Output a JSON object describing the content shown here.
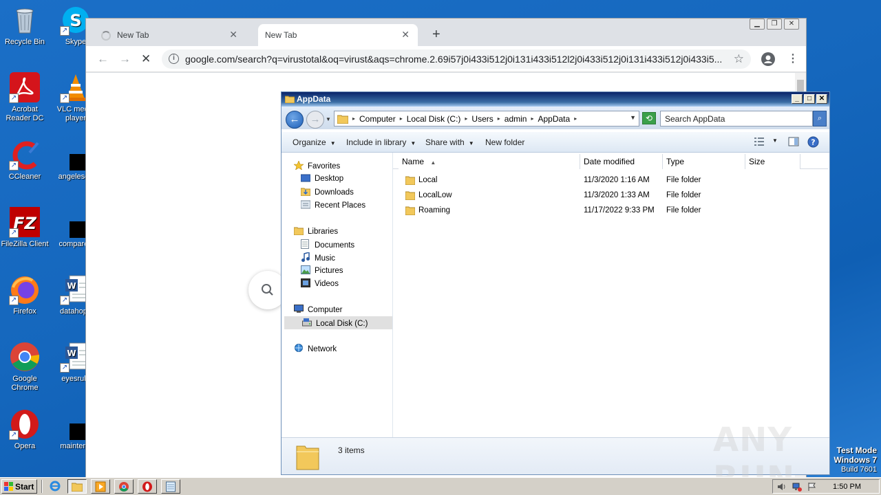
{
  "desktop": {
    "icons": [
      {
        "label": "Recycle Bin",
        "icon": "recycle-bin-icon"
      },
      {
        "label": "Skype",
        "icon": "skype-icon"
      },
      {
        "label": "Acrobat Reader DC",
        "icon": "acrobat-icon"
      },
      {
        "label": "VLC media player",
        "icon": "vlc-icon"
      },
      {
        "label": "CCleaner",
        "icon": "ccleaner-icon"
      },
      {
        "label": "angelesob",
        "icon": "file-icon"
      },
      {
        "label": "FileZilla Client",
        "icon": "filezilla-icon"
      },
      {
        "label": "compareb",
        "icon": "file-icon"
      },
      {
        "label": "Firefox",
        "icon": "firefox-icon"
      },
      {
        "label": "datahope",
        "icon": "word-doc-icon"
      },
      {
        "label": "Google Chrome",
        "icon": "chrome-icon"
      },
      {
        "label": "eyesrule",
        "icon": "word-doc-icon"
      },
      {
        "label": "Opera",
        "icon": "opera-icon"
      },
      {
        "label": "maintena",
        "icon": "file-icon"
      }
    ]
  },
  "chrome": {
    "tabs": [
      {
        "label": "New Tab",
        "state": "loading"
      },
      {
        "label": "New Tab",
        "state": "active"
      }
    ],
    "new_tab_symbol": "+",
    "url": "google.com/search?q=virustotal&oq=virust&aqs=chrome.2.69i57j0i433i512j0i131i433i512l2j0i433i512j0i131i433i512j0i433i5..."
  },
  "explorer": {
    "title": "AppData",
    "breadcrumb": [
      "Computer",
      "Local Disk (C:)",
      "Users",
      "admin",
      "AppData"
    ],
    "search_placeholder": "Search AppData",
    "commands": {
      "organize": "Organize",
      "include_in_library": "Include in library",
      "share_with": "Share with",
      "new_folder": "New folder"
    },
    "nav": {
      "favorites": "Favorites",
      "desktop": "Desktop",
      "downloads": "Downloads",
      "recent_places": "Recent Places",
      "libraries": "Libraries",
      "documents": "Documents",
      "music": "Music",
      "pictures": "Pictures",
      "videos": "Videos",
      "computer": "Computer",
      "local_disk": "Local Disk (C:)",
      "network": "Network"
    },
    "columns": {
      "name": "Name",
      "date_modified": "Date modified",
      "type": "Type",
      "size": "Size"
    },
    "files": [
      {
        "name": "Local",
        "date": "11/3/2020 1:16 AM",
        "type": "File folder"
      },
      {
        "name": "LocalLow",
        "date": "11/3/2020 1:33 AM",
        "type": "File folder"
      },
      {
        "name": "Roaming",
        "date": "11/17/2022 9:33 PM",
        "type": "File folder"
      }
    ],
    "status": "3 items"
  },
  "taskbar": {
    "start_label": "Start",
    "clock": "1:50 PM"
  },
  "watermark": {
    "line1": "Test Mode",
    "line2": "Windows 7",
    "line3": "Build 7601",
    "brand": "ANY RUN"
  },
  "colors": {
    "desktop_bg": "#1567bd",
    "explorer_title": "#0a246a",
    "chrome_frame": "#dee1e6"
  }
}
